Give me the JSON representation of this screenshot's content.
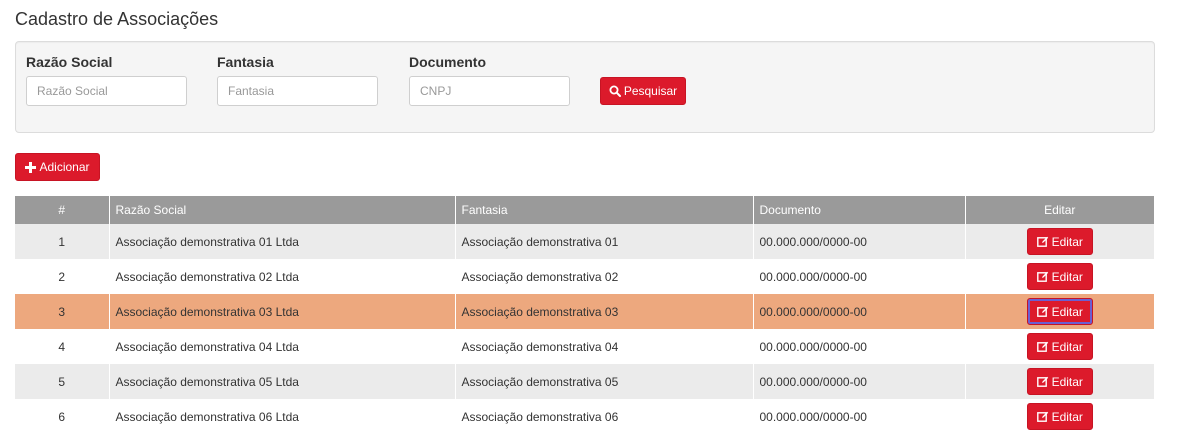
{
  "page": {
    "title": "Cadastro de Associações"
  },
  "filters": {
    "razao_social": {
      "label": "Razão Social",
      "placeholder": "Razão Social"
    },
    "fantasia": {
      "label": "Fantasia",
      "placeholder": "Fantasia"
    },
    "documento": {
      "label": "Documento",
      "placeholder": "CNPJ"
    },
    "search_button": "Pesquisar"
  },
  "actions": {
    "add_button": "Adicionar"
  },
  "table": {
    "headers": {
      "num": "#",
      "razao_social": "Razão Social",
      "fantasia": "Fantasia",
      "documento": "Documento",
      "editar": "Editar"
    },
    "edit_label": "Editar",
    "rows": [
      {
        "num": "1",
        "razao_social": "Associação demonstrativa 01 Ltda",
        "fantasia": "Associação demonstrativa 01",
        "documento": "00.000.000/0000-00"
      },
      {
        "num": "2",
        "razao_social": "Associação demonstrativa 02 Ltda",
        "fantasia": "Associação demonstrativa 02",
        "documento": "00.000.000/0000-00"
      },
      {
        "num": "3",
        "razao_social": "Associação demonstrativa 03 Ltda",
        "fantasia": "Associação demonstrativa 03",
        "documento": "00.000.000/0000-00"
      },
      {
        "num": "4",
        "razao_social": "Associação demonstrativa 04 Ltda",
        "fantasia": "Associação demonstrativa 04",
        "documento": "00.000.000/0000-00"
      },
      {
        "num": "5",
        "razao_social": "Associação demonstrativa 05 Ltda",
        "fantasia": "Associação demonstrativa 05",
        "documento": "00.000.000/0000-00"
      },
      {
        "num": "6",
        "razao_social": "Associação demonstrativa 06 Ltda",
        "fantasia": "Associação demonstrativa 06",
        "documento": "00.000.000/0000-00"
      }
    ]
  },
  "colors": {
    "primary": "#dc1a2b",
    "header_bg": "#9a9a9a",
    "row_alt": "#ebebeb",
    "row_highlight": "#eda87e"
  },
  "icons": {
    "search": "search-icon",
    "add": "plus-icon",
    "edit": "edit-icon"
  }
}
